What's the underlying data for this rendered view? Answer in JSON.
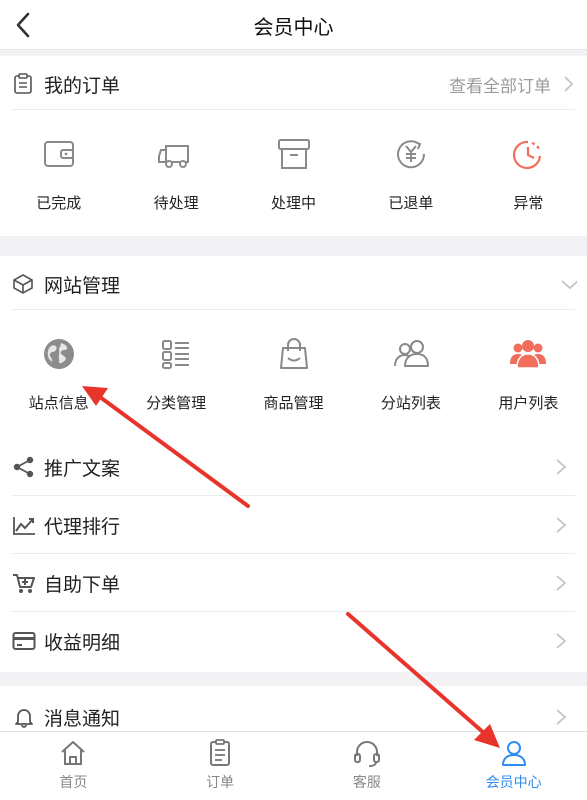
{
  "header": {
    "title": "会员中心",
    "back_icon": "chevron-left-icon"
  },
  "orders": {
    "title": "我的订单",
    "view_all": "查看全部订单",
    "items": [
      {
        "label": "已完成",
        "icon": "wallet-icon"
      },
      {
        "label": "待处理",
        "icon": "truck-icon"
      },
      {
        "label": "处理中",
        "icon": "archive-box-icon"
      },
      {
        "label": "已退单",
        "icon": "yen-refund-icon"
      },
      {
        "label": "异常",
        "icon": "clock-alert-icon"
      }
    ]
  },
  "site": {
    "title": "网站管理",
    "items": [
      {
        "label": "站点信息",
        "icon": "globe-icon"
      },
      {
        "label": "分类管理",
        "icon": "category-list-icon"
      },
      {
        "label": "商品管理",
        "icon": "shopping-bag-icon"
      },
      {
        "label": "分站列表",
        "icon": "users-outline-icon"
      },
      {
        "label": "用户列表",
        "icon": "users-filled-icon"
      }
    ]
  },
  "menu": [
    {
      "label": "推广文案",
      "icon": "share-icon"
    },
    {
      "label": "代理排行",
      "icon": "trend-chart-icon"
    },
    {
      "label": "自助下单",
      "icon": "cart-add-icon"
    },
    {
      "label": "收益明细",
      "icon": "credit-card-icon"
    }
  ],
  "notify": {
    "label": "消息通知",
    "icon": "bell-icon"
  },
  "tabs": [
    {
      "label": "首页",
      "icon": "home-icon"
    },
    {
      "label": "订单",
      "icon": "order-list-icon"
    },
    {
      "label": "客服",
      "icon": "headset-icon"
    },
    {
      "label": "会员中心",
      "icon": "user-icon",
      "active": true
    }
  ],
  "colors": {
    "accent_blue": "#2f8cf0",
    "alert_orange": "#f26d5b",
    "annotation_red": "#e8342a"
  }
}
